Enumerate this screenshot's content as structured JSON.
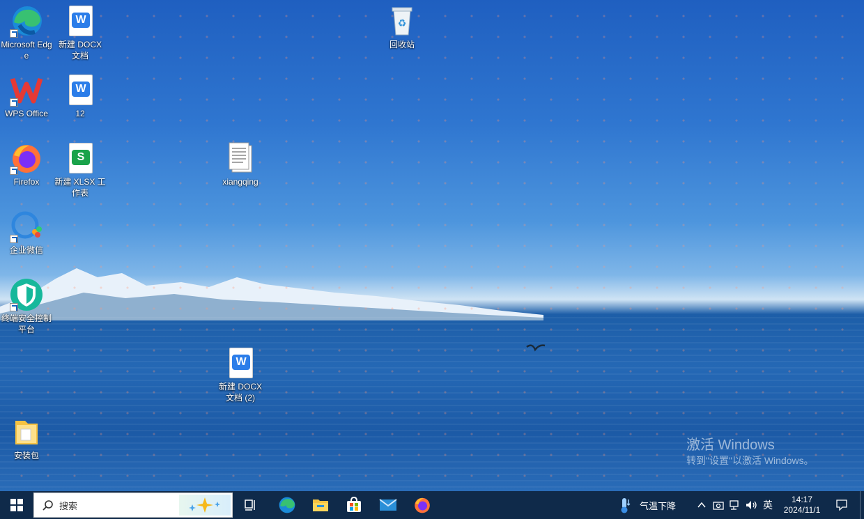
{
  "desktop": {
    "icons": {
      "edge": {
        "label": "Microsoft Edge"
      },
      "docx1": {
        "label": "新建 DOCX 文档"
      },
      "recycle": {
        "label": "回收站"
      },
      "wps": {
        "label": "WPS Office"
      },
      "doc12": {
        "label": "12"
      },
      "firefox": {
        "label": "Firefox"
      },
      "xlsx": {
        "label": "新建 XLSX 工作表"
      },
      "xiangqing": {
        "label": "xiangqing"
      },
      "wecom": {
        "label": "企业微信"
      },
      "security": {
        "label": "终端安全控制平台"
      },
      "docx2": {
        "label": "新建 DOCX 文档 (2)"
      },
      "installer": {
        "label": "安装包"
      }
    },
    "watermark": {
      "line1": "激活 Windows",
      "line2": "转到\"设置\"以激活 Windows。"
    }
  },
  "taskbar": {
    "search_placeholder": "搜索",
    "weather_text": "气温下降",
    "ime": "英",
    "time": "14:17",
    "date": "2024/11/1",
    "apps": [
      "task-view",
      "edge",
      "file-explorer",
      "microsoft-store",
      "mail",
      "firefox"
    ]
  },
  "colors": {
    "taskbar": "#0f2a4a",
    "accent": "#1e6fd9"
  }
}
